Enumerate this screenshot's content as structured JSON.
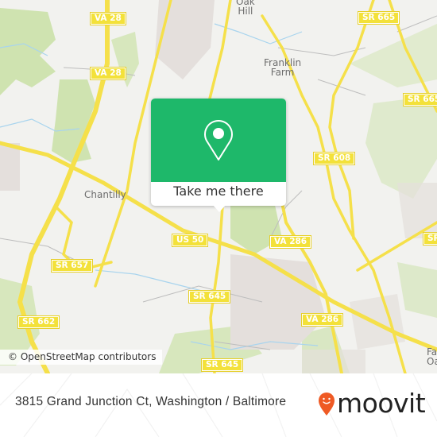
{
  "map": {
    "colors": {
      "background": "#f2f2ef",
      "park": "#cfe3b0",
      "residential": "#e4dfdc",
      "road": "#f5e04a",
      "water": "#a8d4ee",
      "popup_green": "#1eb86a",
      "moovit_orange": "#ef5a24"
    },
    "places": [
      {
        "id": "oak-hill",
        "label": "Oak\nHill"
      },
      {
        "id": "franklin-farm",
        "label": "Franklin\nFarm"
      },
      {
        "id": "chantilly",
        "label": "Chantilly"
      },
      {
        "id": "fair-oaks",
        "label": "Fa\nOa"
      }
    ],
    "shields": [
      {
        "id": "va28-top",
        "label": "VA 28"
      },
      {
        "id": "va28-mid",
        "label": "VA 28"
      },
      {
        "id": "sr665-top",
        "label": "SR 665"
      },
      {
        "id": "sr665-right",
        "label": "SR 665"
      },
      {
        "id": "sr608",
        "label": "SR 608"
      },
      {
        "id": "us50",
        "label": "US 50"
      },
      {
        "id": "va286-a",
        "label": "VA 286"
      },
      {
        "id": "sr657",
        "label": "SR 657"
      },
      {
        "id": "sr645-a",
        "label": "SR 645"
      },
      {
        "id": "sr662",
        "label": "SR 662"
      },
      {
        "id": "va286-b",
        "label": "VA 286"
      },
      {
        "id": "sr645-b",
        "label": "SR 645"
      },
      {
        "id": "va286-c",
        "label": "VA 286"
      },
      {
        "id": "sr-right",
        "label": "SR"
      }
    ],
    "attribution": "© OpenStreetMap contributors"
  },
  "popup": {
    "icon": "location-pin-icon",
    "button_label": "Take me there"
  },
  "footer": {
    "address": "3815 Grand Junction Ct, Washington / Baltimore",
    "logo_text": "moovit",
    "logo_icon": "moovit-smiley-pin-icon"
  }
}
